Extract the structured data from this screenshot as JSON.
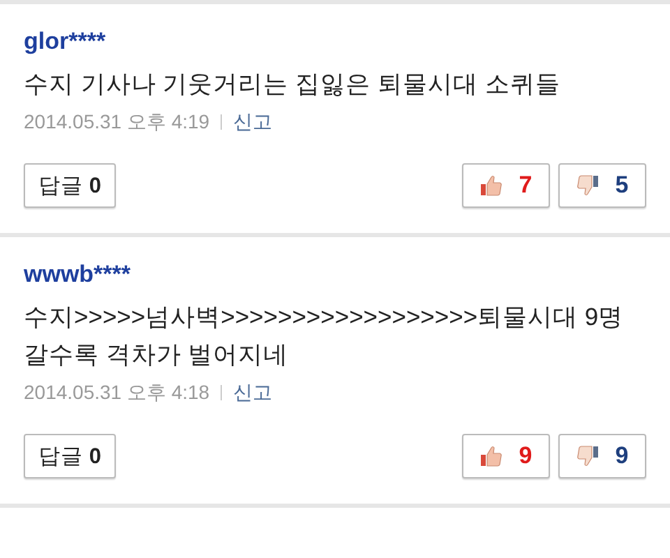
{
  "comments": [
    {
      "username": "glor****",
      "text": "수지 기사나 기웃거리는 집잃은 퇴물시대 소퀴들",
      "date": "2014.05.31 오후 4:19",
      "report": "신고",
      "reply": "답글 **0**",
      "likes": "7",
      "dislikes": "5"
    },
    {
      "username": "wwwb****",
      "text": "수지>>>>>넘사벽>>>>>>>>>>>>>>>>>>퇴물시대 9명 갈수록 격차가 벌어지네",
      "date": "2014.05.31 오후 4:18",
      "report": "신고",
      "reply": "답글 **0**",
      "likes": "9",
      "dislikes": "9"
    }
  ]
}
